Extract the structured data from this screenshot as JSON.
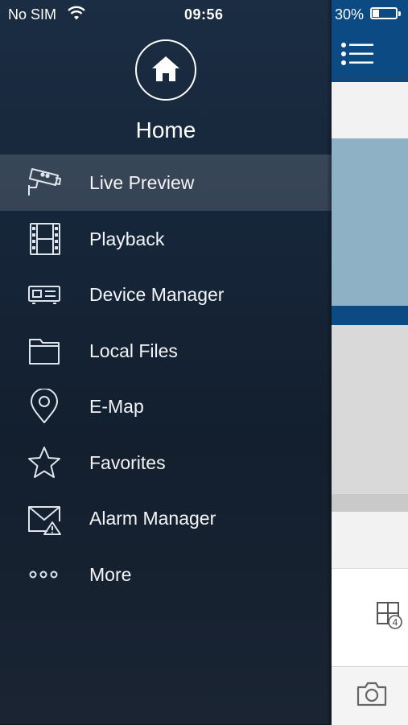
{
  "status_bar": {
    "carrier": "No SIM",
    "time": "09:56",
    "battery": "30%",
    "battery_level": 0.3
  },
  "drawer": {
    "header_title": "Home",
    "header_icon": "home-icon",
    "active_index": 0,
    "items": [
      {
        "label": "Live Preview",
        "icon": "cctv-camera-icon"
      },
      {
        "label": "Playback",
        "icon": "film-strip-icon"
      },
      {
        "label": "Device Manager",
        "icon": "dvr-device-icon"
      },
      {
        "label": "Local Files",
        "icon": "folder-icon"
      },
      {
        "label": "E-Map",
        "icon": "map-pin-icon"
      },
      {
        "label": "Favorites",
        "icon": "star-icon"
      },
      {
        "label": "Alarm Manager",
        "icon": "alarm-mail-icon"
      },
      {
        "label": "More",
        "icon": "more-dots-icon"
      }
    ]
  },
  "content_peek": {
    "topbar_color": "#0b4a82",
    "menu_icon": "menu-list-icon",
    "grid_icon": "grid-4-icon",
    "grid_badge": "4",
    "camera_icon": "camera-icon"
  }
}
